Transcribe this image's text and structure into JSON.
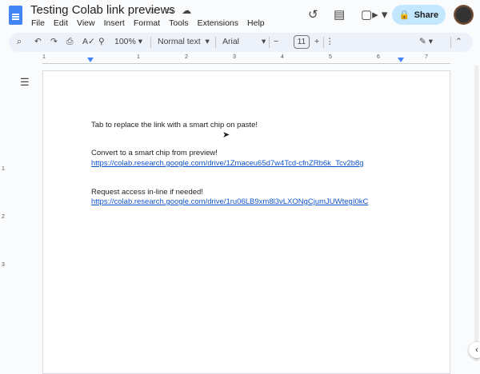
{
  "title": "Testing Colab link previews",
  "menu": [
    "File",
    "Edit",
    "View",
    "Insert",
    "Format",
    "Tools",
    "Extensions",
    "Help"
  ],
  "share_label": "Share",
  "toolbar": {
    "zoom": "100%",
    "style": "Normal text",
    "font": "Arial",
    "font_size": "11"
  },
  "ruler_labels": [
    "1",
    "1",
    "2",
    "3",
    "4",
    "5",
    "6",
    "7"
  ],
  "vruler_labels": [
    "1",
    "2",
    "3"
  ],
  "doc": {
    "line1": "Tab to replace the link with a smart chip on paste!",
    "line2": "Convert to a smart chip from preview!",
    "link1": "https://colab.research.google.com/drive/1Zmaceu65d7w4Tcd-cfnZRb6k_Tcv2b8g",
    "line3": "Request access in-line if needed!",
    "link2": "https://colab.research.google.com/drive/1ru06LB9xm8l3vLXONgCjumJUWtegI0kC"
  },
  "colors": {
    "accent": "#c2e7ff",
    "link": "#1155cc",
    "logo": "#4285f4"
  }
}
